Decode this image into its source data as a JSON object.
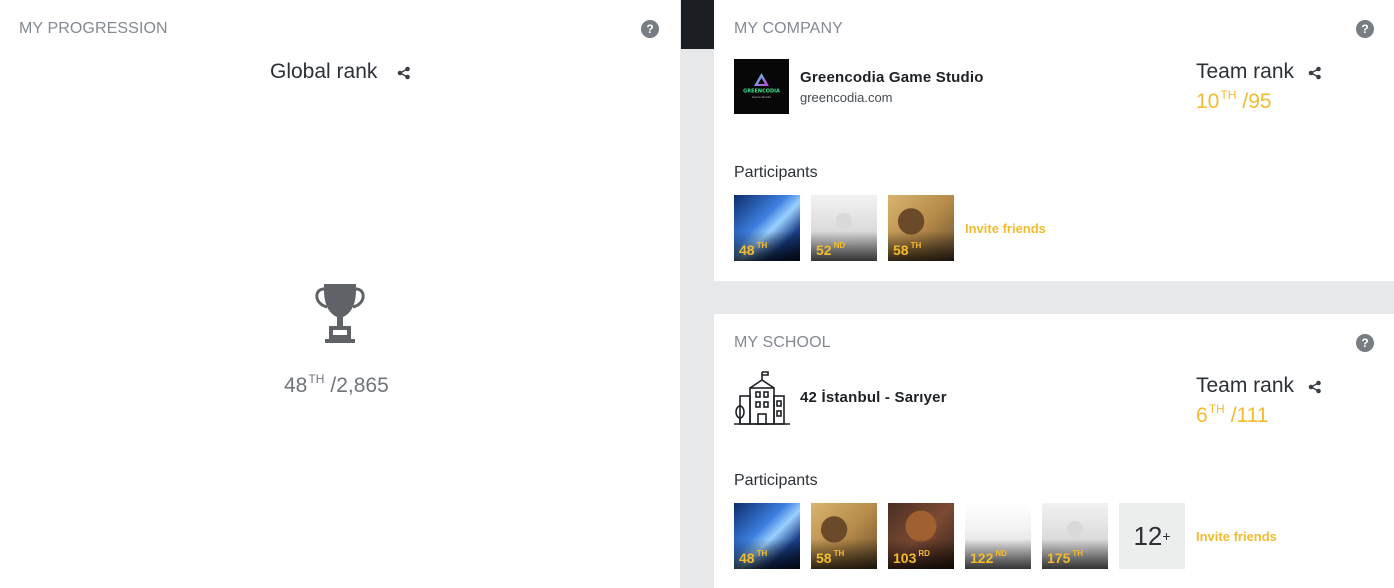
{
  "progression": {
    "title": "MY PROGRESSION",
    "help": "?",
    "global_rank_label": "Global rank",
    "rank": "48",
    "rank_suffix": "TH",
    "total": "/2,865"
  },
  "company": {
    "title": "MY COMPANY",
    "help": "?",
    "logo_text": "GREENCODIA",
    "logo_subtext": "Game Studio",
    "name": "Greencodia Game Studio",
    "website": "greencodia.com",
    "team_rank_label": "Team rank",
    "rank": "10",
    "rank_suffix": "TH",
    "total": "/95",
    "participants_label": "Participants",
    "participants": [
      {
        "rank": "48",
        "suffix": "TH",
        "style": "blue"
      },
      {
        "rank": "52",
        "suffix": "ND",
        "style": "default"
      },
      {
        "rank": "58",
        "suffix": "TH",
        "style": "cartoon"
      }
    ],
    "invite_label": "Invite friends"
  },
  "school": {
    "title": "MY SCHOOL",
    "help": "?",
    "name": "42 İstanbul - Sarıyer",
    "team_rank_label": "Team rank",
    "rank": "6",
    "rank_suffix": "TH",
    "total": "/111",
    "participants_label": "Participants",
    "participants": [
      {
        "rank": "48",
        "suffix": "TH",
        "style": "blue"
      },
      {
        "rank": "58",
        "suffix": "TH",
        "style": "cartoon"
      },
      {
        "rank": "103",
        "suffix": "RD",
        "style": "brown"
      },
      {
        "rank": "122",
        "suffix": "ND",
        "style": "blank"
      },
      {
        "rank": "175",
        "suffix": "TH",
        "style": "default"
      }
    ],
    "more_count": "12",
    "more_plus": "+",
    "invite_label": "Invite friends"
  },
  "colors": {
    "accent": "#f2bb30",
    "background": "#e7e8e9",
    "panel": "#ffffff",
    "title_gray": "#838a92"
  }
}
